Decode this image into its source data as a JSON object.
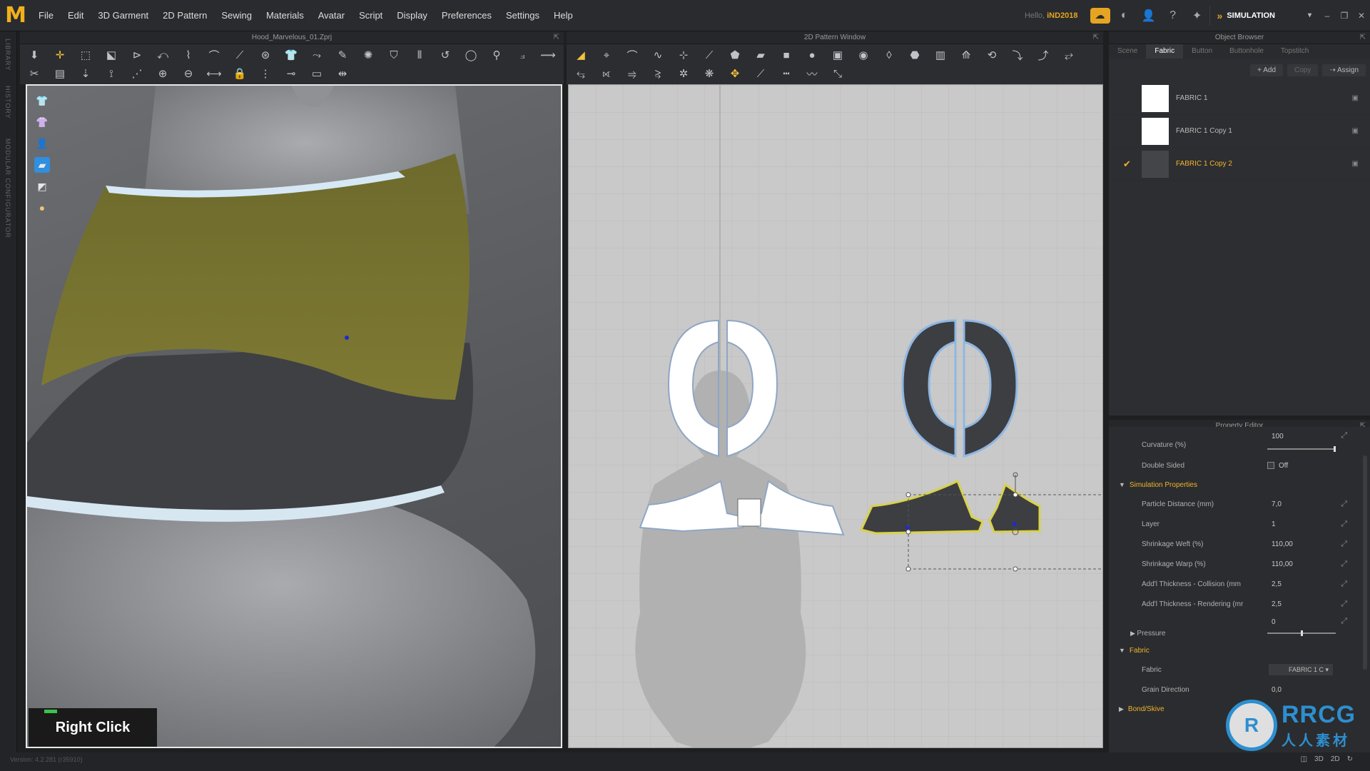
{
  "app": {
    "logo_letter": "M",
    "menu": [
      "File",
      "Edit",
      "3D Garment",
      "2D Pattern",
      "Sewing",
      "Materials",
      "Avatar",
      "Script",
      "Display",
      "Preferences",
      "Settings",
      "Help"
    ],
    "hello_label": "Hello,",
    "username": "iND2018",
    "mode_label": "SIMULATION",
    "accent_color": "#f0b42c"
  },
  "side_strip": [
    "LIBRARY",
    "HISTORY",
    "MODULAR CONFIGURATOR"
  ],
  "viewport3d": {
    "title": "Hood_Marvelous_01.Zprj",
    "hint_label": "Right Click",
    "hint_color": "#3ac24a"
  },
  "viewport2d": {
    "title": "2D Pattern Window"
  },
  "object_browser": {
    "title": "Object Browser",
    "tabs": [
      "Scene",
      "Fabric",
      "Button",
      "Buttonhole",
      "Topstitch"
    ],
    "active_tab": "Fabric",
    "actions": {
      "add": "+ Add",
      "copy": "Copy",
      "assign": "Assign"
    },
    "fabrics": [
      {
        "name": "FABRIC 1",
        "swatch": "#ffffff",
        "selected": false
      },
      {
        "name": "FABRIC 1 Copy 1",
        "swatch": "#ffffff",
        "selected": false
      },
      {
        "name": "FABRIC 1 Copy 2",
        "swatch": "#444548",
        "selected": true
      }
    ]
  },
  "property_editor": {
    "title": "Property Editor",
    "curvature": {
      "label": "Curvature (%)",
      "value": "100",
      "level": 1.0
    },
    "double_sided": {
      "label": "Double Sided",
      "value": "Off"
    },
    "simulation_section": "Simulation Properties",
    "simulation_props": [
      {
        "label": "Particle Distance (mm)",
        "value": "7,0"
      },
      {
        "label": "Layer",
        "value": "1"
      },
      {
        "label": "Shrinkage Weft (%)",
        "value": "110,00"
      },
      {
        "label": "Shrinkage Warp (%)",
        "value": "110,00"
      },
      {
        "label": "Add'l Thickness - Collision (mm",
        "value": "2,5"
      },
      {
        "label": "Add'l Thickness - Rendering (mr",
        "value": "2,5"
      }
    ],
    "pressure": {
      "label": "Pressure",
      "value": "0",
      "level": 0.5
    },
    "fabric_section": "Fabric",
    "fabric_field": {
      "label": "Fabric",
      "value": "FABRIC 1 C"
    },
    "grain": {
      "label": "Grain Direction",
      "value": "0,0"
    },
    "bond_section": "Bond/Skive"
  },
  "status": {
    "version": "Version: 4.2.281 (r35910)",
    "view_toggles": [
      "3D",
      "2D"
    ]
  },
  "watermark": {
    "logo": "R",
    "line1": "RRCG",
    "line2": "人人素材"
  }
}
